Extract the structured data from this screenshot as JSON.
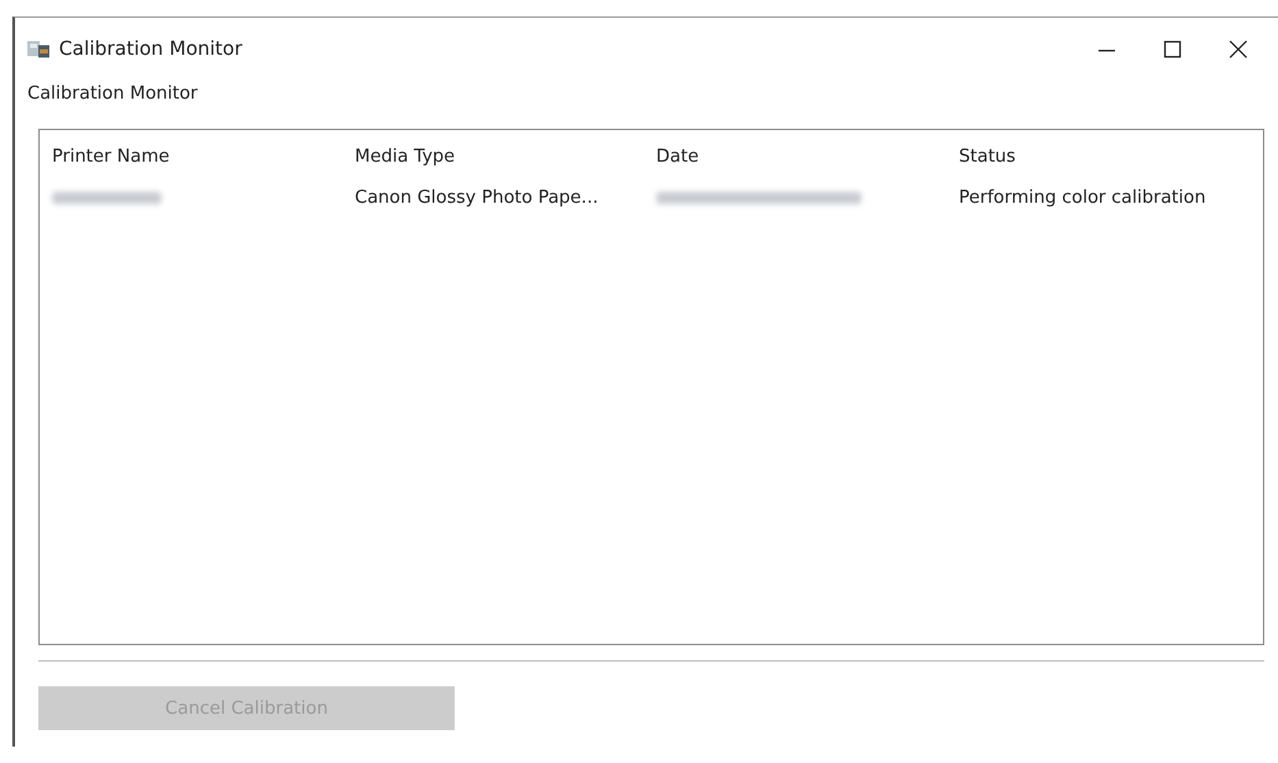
{
  "window": {
    "title": "Calibration Monitor"
  },
  "group_label": "Calibration Monitor",
  "table": {
    "columns": [
      "Printer Name",
      "Media Type",
      "Date",
      "Status"
    ],
    "rows": [
      {
        "cells": [
          {
            "kind": "redacted"
          },
          {
            "kind": "text",
            "text": "Canon Glossy Photo Pape..."
          },
          {
            "kind": "redacted"
          },
          {
            "kind": "text",
            "text": "Performing color calibration"
          }
        ]
      }
    ]
  },
  "buttons": [
    {
      "label": "Cancel Calibration",
      "disabled": true
    }
  ]
}
